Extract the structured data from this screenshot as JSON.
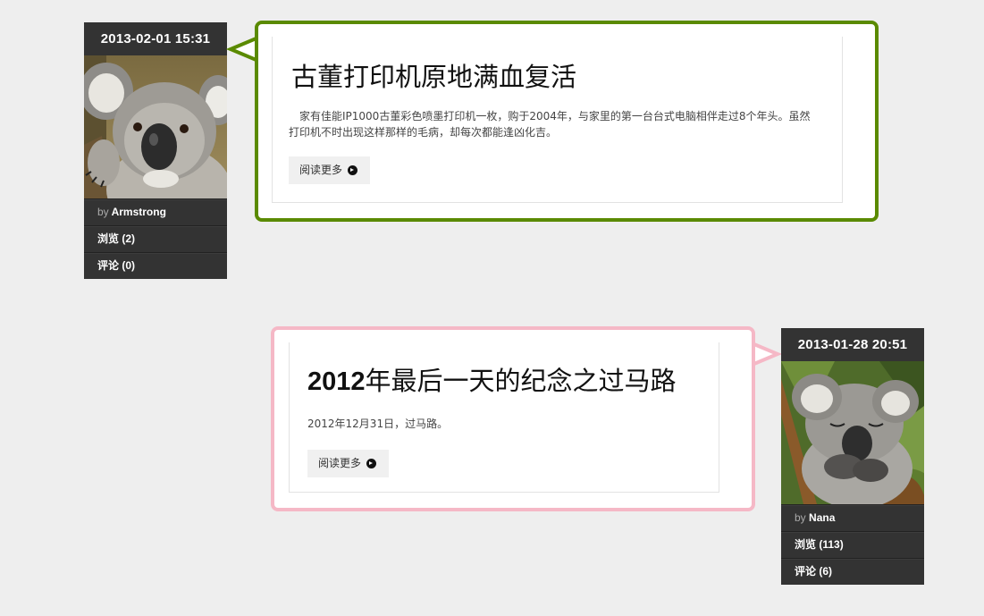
{
  "posts": [
    {
      "date": "2013-02-01 15:31",
      "author_prefix": "by",
      "author": "Armstrong",
      "views": "浏览 (2)",
      "comments": "评论 (0)",
      "title": "古董打印机原地满血复活",
      "excerpt": "　家有佳能IP1000古董彩色喷墨打印机一枚，购于2004年，与家里的第一台台式电脑相伴走过8个年头。虽然打印机不时出现这样那样的毛病，却每次都能逢凶化吉。",
      "read_more": "阅读更多",
      "border_color": "#5a8a00"
    },
    {
      "date": "2013-01-28 20:51",
      "author_prefix": "by",
      "author": "Nana",
      "views": "浏览 (113)",
      "comments": "评论 (6)",
      "title_prefix": "2012",
      "title_rest": "年最后一天的纪念之过马路",
      "excerpt": "2012年12月31日，过马路。",
      "read_more": "阅读更多",
      "border_color": "#f5b8c6"
    }
  ],
  "icons": {
    "read_more_icon": "circle-arrow-right-icon",
    "photo_1": "koala-photo",
    "photo_2": "sleeping-koala-photo"
  }
}
